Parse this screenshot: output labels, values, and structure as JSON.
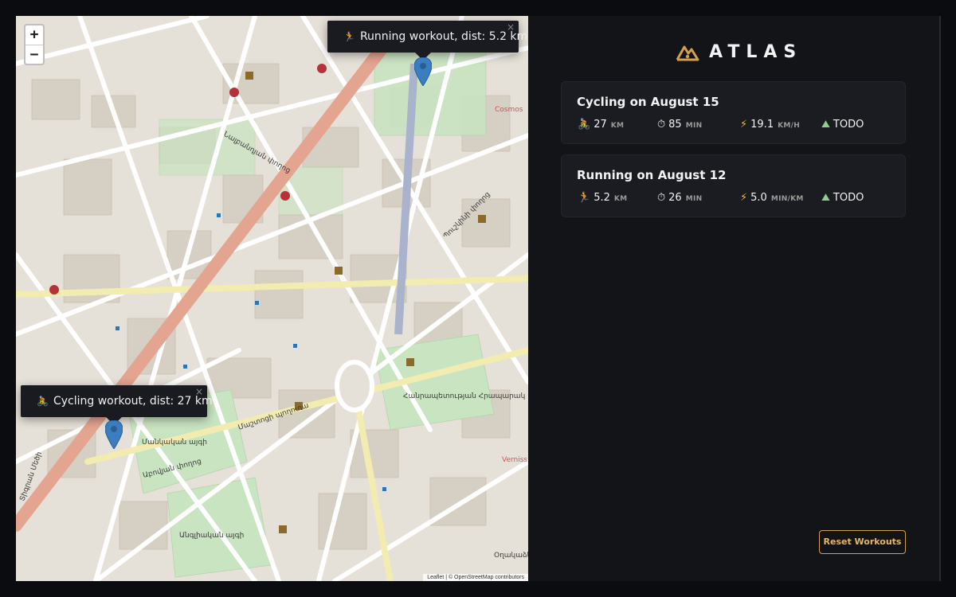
{
  "app": {
    "title": "ATLAS",
    "accent": "#d1a24a"
  },
  "map": {
    "zoom_in": "+",
    "zoom_out": "−",
    "attribution": "Leaflet | © OpenStreetMap contributors",
    "popups": [
      {
        "icon": "running-icon",
        "emoji": "🏃",
        "text": "Running workout, dist: 5.2 km",
        "close": "×"
      },
      {
        "icon": "cycling-icon",
        "emoji": "🚴",
        "text": "Cycling workout, dist: 27 km",
        "close": "×"
      }
    ],
    "labels": {
      "square": "Հանրապետության Հրապարակ",
      "park1": "Մանկական այգի",
      "park2": "Անգլիական այգի",
      "street1": "Մաշտոցի պողոտա",
      "street2": "Տիգրան Մեծի",
      "street3": "Նալբանդյան փողոց",
      "street4": "Աբովյան փողոց",
      "street5": "Պուշկինի փողոց",
      "corner1": "Cosmos",
      "corner2": "Verniss",
      "corner3": "Օղակաձև զբոսայգի"
    }
  },
  "workouts": [
    {
      "title": "Cycling on August 15",
      "stats": [
        {
          "icon": "cycling-icon",
          "emoji": "🚴",
          "value": "27",
          "unit": "KM"
        },
        {
          "icon": "stopwatch-icon",
          "emoji": "⏱",
          "value": "85",
          "unit": "MIN"
        },
        {
          "icon": "lightning-icon",
          "emoji": "⚡",
          "value": "19.1",
          "unit": "KM/H"
        },
        {
          "icon": "mountain-icon",
          "emoji": "⛰",
          "value": "TODO",
          "unit": ""
        }
      ]
    },
    {
      "title": "Running on August 12",
      "stats": [
        {
          "icon": "running-icon",
          "emoji": "🏃",
          "value": "5.2",
          "unit": "KM"
        },
        {
          "icon": "stopwatch-icon",
          "emoji": "⏱",
          "value": "26",
          "unit": "MIN"
        },
        {
          "icon": "lightning-icon",
          "emoji": "⚡",
          "value": "5.0",
          "unit": "MIN/KM"
        },
        {
          "icon": "mountain-icon",
          "emoji": "⛰",
          "value": "TODO",
          "unit": ""
        }
      ]
    }
  ],
  "reset_label": "Reset Workouts"
}
